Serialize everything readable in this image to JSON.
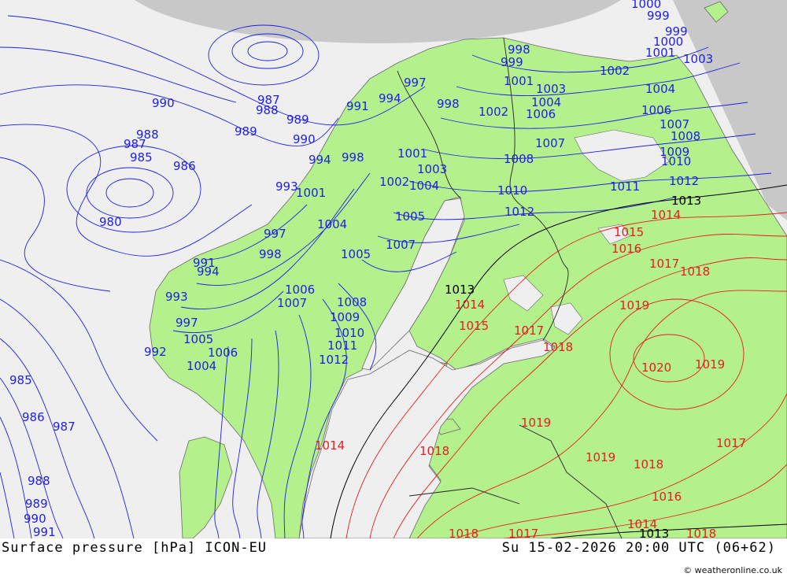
{
  "title": "Surface pressure [hPa] ICON-EU",
  "valid_time": "Su 15-02-2026 20:00 UTC (06+62)",
  "credit": "© weatheronline.co.uk",
  "colors": {
    "sea": "#efefef",
    "land": "#b4f08c",
    "outside_domain": "#c8c8c8",
    "low_isobar": "#1e1ee6",
    "mid_isobar": "#000000",
    "high_isobar": "#e61e1e"
  },
  "isobar_labels": [
    {
      "text": "1000",
      "color": "blue"
    },
    {
      "text": "999",
      "color": "blue"
    },
    {
      "text": "999",
      "color": "blue"
    },
    {
      "text": "1000",
      "color": "blue"
    },
    {
      "text": "1001",
      "color": "blue"
    },
    {
      "text": "1003",
      "color": "blue"
    },
    {
      "text": "998",
      "color": "blue"
    },
    {
      "text": "999",
      "color": "blue"
    },
    {
      "text": "1002",
      "color": "blue"
    },
    {
      "text": "1001",
      "color": "blue"
    },
    {
      "text": "1004",
      "color": "blue"
    },
    {
      "text": "997",
      "color": "blue"
    },
    {
      "text": "1003",
      "color": "blue"
    },
    {
      "text": "994",
      "color": "blue"
    },
    {
      "text": "998",
      "color": "blue"
    },
    {
      "text": "1004",
      "color": "blue"
    },
    {
      "text": "1006",
      "color": "blue"
    },
    {
      "text": "990",
      "color": "blue"
    },
    {
      "text": "987",
      "color": "blue"
    },
    {
      "text": "988",
      "color": "blue"
    },
    {
      "text": "989",
      "color": "blue"
    },
    {
      "text": "991",
      "color": "blue"
    },
    {
      "text": "1002",
      "color": "blue"
    },
    {
      "text": "1006",
      "color": "blue"
    },
    {
      "text": "1007",
      "color": "blue"
    },
    {
      "text": "1008",
      "color": "blue"
    },
    {
      "text": "989",
      "color": "blue"
    },
    {
      "text": "990",
      "color": "blue"
    },
    {
      "text": "988",
      "color": "blue"
    },
    {
      "text": "987",
      "color": "blue"
    },
    {
      "text": "985",
      "color": "blue"
    },
    {
      "text": "986",
      "color": "blue"
    },
    {
      "text": "994",
      "color": "blue"
    },
    {
      "text": "998",
      "color": "blue"
    },
    {
      "text": "1001",
      "color": "blue"
    },
    {
      "text": "1007",
      "color": "blue"
    },
    {
      "text": "1009",
      "color": "blue"
    },
    {
      "text": "1008",
      "color": "blue"
    },
    {
      "text": "1010",
      "color": "blue"
    },
    {
      "text": "1003",
      "color": "blue"
    },
    {
      "text": "1002",
      "color": "blue"
    },
    {
      "text": "1004",
      "color": "blue"
    },
    {
      "text": "1011",
      "color": "blue"
    },
    {
      "text": "1012",
      "color": "blue"
    },
    {
      "text": "1013",
      "color": "black"
    },
    {
      "text": "1014",
      "color": "red"
    },
    {
      "text": "993",
      "color": "blue"
    },
    {
      "text": "1001",
      "color": "blue"
    },
    {
      "text": "980",
      "color": "blue"
    },
    {
      "text": "1005",
      "color": "blue"
    },
    {
      "text": "1004",
      "color": "blue"
    },
    {
      "text": "1010",
      "color": "blue"
    },
    {
      "text": "1012",
      "color": "blue"
    },
    {
      "text": "1015",
      "color": "red"
    },
    {
      "text": "1016",
      "color": "red"
    },
    {
      "text": "997",
      "color": "blue"
    },
    {
      "text": "998",
      "color": "blue"
    },
    {
      "text": "1007",
      "color": "blue"
    },
    {
      "text": "1005",
      "color": "blue"
    },
    {
      "text": "1017",
      "color": "red"
    },
    {
      "text": "1018",
      "color": "red"
    },
    {
      "text": "991",
      "color": "blue"
    },
    {
      "text": "994",
      "color": "blue"
    },
    {
      "text": "1006",
      "color": "blue"
    },
    {
      "text": "1007",
      "color": "blue"
    },
    {
      "text": "1013",
      "color": "black"
    },
    {
      "text": "993",
      "color": "blue"
    },
    {
      "text": "1008",
      "color": "blue"
    },
    {
      "text": "1014",
      "color": "red"
    },
    {
      "text": "1019",
      "color": "red"
    },
    {
      "text": "997",
      "color": "blue"
    },
    {
      "text": "1009",
      "color": "blue"
    },
    {
      "text": "1015",
      "color": "red"
    },
    {
      "text": "1010",
      "color": "blue"
    },
    {
      "text": "1017",
      "color": "red"
    },
    {
      "text": "1005",
      "color": "blue"
    },
    {
      "text": "1011",
      "color": "blue"
    },
    {
      "text": "1018",
      "color": "red"
    },
    {
      "text": "992",
      "color": "blue"
    },
    {
      "text": "1006",
      "color": "blue"
    },
    {
      "text": "1004",
      "color": "blue"
    },
    {
      "text": "1012",
      "color": "blue"
    },
    {
      "text": "1020",
      "color": "red"
    },
    {
      "text": "1019",
      "color": "red"
    },
    {
      "text": "985",
      "color": "blue"
    },
    {
      "text": "986",
      "color": "blue"
    },
    {
      "text": "987",
      "color": "blue"
    },
    {
      "text": "1019",
      "color": "red"
    },
    {
      "text": "1014",
      "color": "red"
    },
    {
      "text": "1018",
      "color": "red"
    },
    {
      "text": "1017",
      "color": "red"
    },
    {
      "text": "1019",
      "color": "red"
    },
    {
      "text": "1018",
      "color": "red"
    },
    {
      "text": "988",
      "color": "blue"
    },
    {
      "text": "1016",
      "color": "red"
    },
    {
      "text": "989",
      "color": "blue"
    },
    {
      "text": "990",
      "color": "blue"
    },
    {
      "text": "991",
      "color": "blue"
    },
    {
      "text": "1014",
      "color": "red"
    },
    {
      "text": "1018",
      "color": "red"
    },
    {
      "text": "1017",
      "color": "red"
    },
    {
      "text": "1013",
      "color": "black"
    },
    {
      "text": "1018",
      "color": "red"
    }
  ]
}
